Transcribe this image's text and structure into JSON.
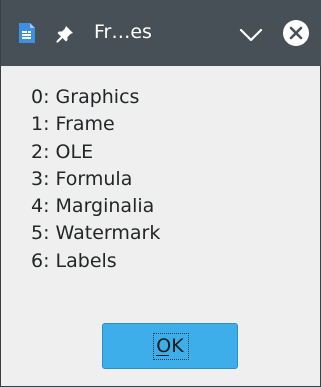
{
  "window": {
    "title": "Fr…es"
  },
  "items": [
    "0: Graphics",
    "1: Frame",
    "2: OLE",
    "3: Formula",
    "4: Marginalia",
    "5: Watermark",
    "6: Labels"
  ],
  "buttons": {
    "ok_label": "OK"
  },
  "icons": {
    "app": "document-app-icon",
    "pin": "pin-icon",
    "chevron": "chevron-down-icon",
    "close": "close-icon"
  },
  "colors": {
    "titlebar": "#475057",
    "accent": "#3daee9",
    "background": "#efefef"
  }
}
